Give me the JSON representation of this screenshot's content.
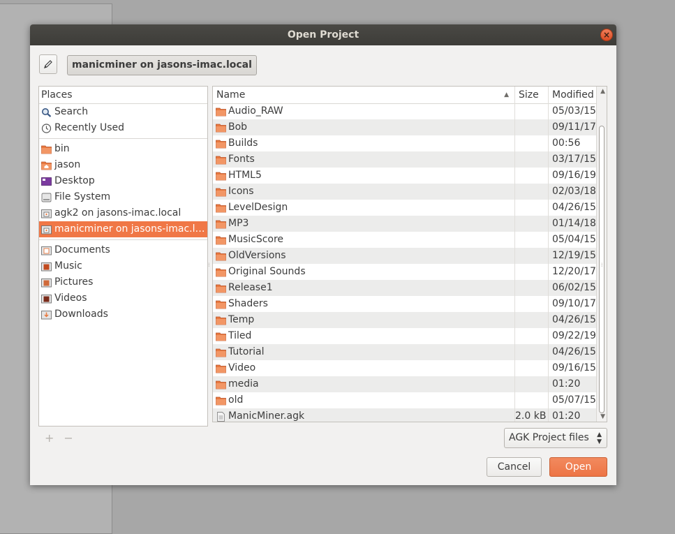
{
  "dialog": {
    "title": "Open Project"
  },
  "location": {
    "path_label": "manicminer on jasons-imac.local"
  },
  "places": {
    "header": "Places",
    "groups": [
      [
        {
          "label": "Search",
          "icon": "search-icon"
        },
        {
          "label": "Recently Used",
          "icon": "clock-icon"
        }
      ],
      [
        {
          "label": "bin",
          "icon": "folder-icon"
        },
        {
          "label": "jason",
          "icon": "home-folder-icon"
        },
        {
          "label": "Desktop",
          "icon": "desktop-icon"
        },
        {
          "label": "File System",
          "icon": "drive-icon"
        },
        {
          "label": "agk2 on jasons-imac.local",
          "icon": "network-share-icon"
        },
        {
          "label": "manicminer on jasons-imac.lo...",
          "icon": "network-share-icon",
          "selected": true
        }
      ],
      [
        {
          "label": "Documents",
          "icon": "documents-folder-icon"
        },
        {
          "label": "Music",
          "icon": "music-folder-icon"
        },
        {
          "label": "Pictures",
          "icon": "pictures-folder-icon"
        },
        {
          "label": "Videos",
          "icon": "videos-folder-icon"
        },
        {
          "label": "Downloads",
          "icon": "downloads-folder-icon"
        }
      ]
    ]
  },
  "files": {
    "columns": {
      "name": "Name",
      "size": "Size",
      "modified": "Modified"
    },
    "rows": [
      {
        "name": "Audio_RAW",
        "size": "",
        "modified": "05/03/15",
        "type": "folder"
      },
      {
        "name": "Bob",
        "size": "",
        "modified": "09/11/17",
        "type": "folder"
      },
      {
        "name": "Builds",
        "size": "",
        "modified": "00:56",
        "type": "folder"
      },
      {
        "name": "Fonts",
        "size": "",
        "modified": "03/17/15",
        "type": "folder"
      },
      {
        "name": "HTML5",
        "size": "",
        "modified": "09/16/19",
        "type": "folder"
      },
      {
        "name": "Icons",
        "size": "",
        "modified": "02/03/18",
        "type": "folder"
      },
      {
        "name": "LevelDesign",
        "size": "",
        "modified": "04/26/15",
        "type": "folder"
      },
      {
        "name": "MP3",
        "size": "",
        "modified": "01/14/18",
        "type": "folder"
      },
      {
        "name": "MusicScore",
        "size": "",
        "modified": "05/04/15",
        "type": "folder"
      },
      {
        "name": "OldVersions",
        "size": "",
        "modified": "12/19/15",
        "type": "folder"
      },
      {
        "name": "Original Sounds",
        "size": "",
        "modified": "12/20/17",
        "type": "folder"
      },
      {
        "name": "Release1",
        "size": "",
        "modified": "06/02/15",
        "type": "folder"
      },
      {
        "name": "Shaders",
        "size": "",
        "modified": "09/10/17",
        "type": "folder"
      },
      {
        "name": "Temp",
        "size": "",
        "modified": "04/26/15",
        "type": "folder"
      },
      {
        "name": "Tiled",
        "size": "",
        "modified": "09/22/19",
        "type": "folder"
      },
      {
        "name": "Tutorial",
        "size": "",
        "modified": "04/26/15",
        "type": "folder"
      },
      {
        "name": "Video",
        "size": "",
        "modified": "09/16/15",
        "type": "folder"
      },
      {
        "name": "media",
        "size": "",
        "modified": "01:20",
        "type": "folder"
      },
      {
        "name": "old",
        "size": "",
        "modified": "05/07/15",
        "type": "folder"
      },
      {
        "name": "ManicMiner.agk",
        "size": "2.0 kB",
        "modified": "01:20",
        "type": "file"
      }
    ]
  },
  "filter": {
    "selected": "AGK Project files"
  },
  "actions": {
    "cancel_label": "Cancel",
    "open_label": "Open"
  },
  "colors": {
    "accent": "#f07746",
    "folder": "#e8793f",
    "titlebar": "#3d3c38"
  }
}
